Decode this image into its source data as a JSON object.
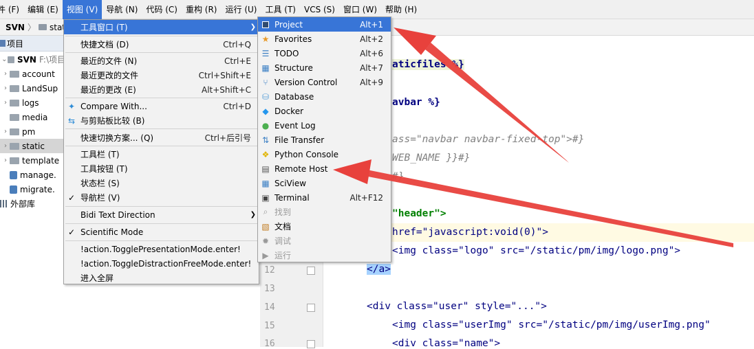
{
  "menubar": {
    "items": [
      "件 (F)",
      "编辑 (E)",
      "视图 (V)",
      "导航 (N)",
      "代码 (C)",
      "重构 (R)",
      "运行 (U)",
      "工具 (T)",
      "VCS (S)",
      "窗口 (W)",
      "帮助 (H)"
    ]
  },
  "breadcrumb": {
    "project": "SVN",
    "folder": "stati"
  },
  "project_panel": {
    "title": "项目"
  },
  "tree": {
    "root_name": "SVN",
    "root_path": "F:\\项目",
    "items": [
      "account",
      "LandSup",
      "logs",
      "media",
      "pm",
      "static",
      "template",
      "manage.",
      "migrate.",
      "外部库"
    ]
  },
  "view_menu": {
    "items": [
      {
        "label": "工具窗口 (T)",
        "shortcut": ""
      },
      {
        "label": "快捷文档 (D)",
        "shortcut": "Ctrl+Q"
      },
      {
        "label": "最近的文件 (N)",
        "shortcut": "Ctrl+E"
      },
      {
        "label": "最近更改的文件",
        "shortcut": "Ctrl+Shift+E"
      },
      {
        "label": "最近的更改 (E)",
        "shortcut": "Alt+Shift+C"
      },
      {
        "label": "Compare With...",
        "shortcut": "Ctrl+D"
      },
      {
        "label": "与剪贴板比较 (B)",
        "shortcut": ""
      },
      {
        "label": "快速切换方案... (Q)",
        "shortcut": "Ctrl+后引号"
      },
      {
        "label": "工具栏 (T)",
        "shortcut": ""
      },
      {
        "label": "工具按钮 (T)",
        "shortcut": ""
      },
      {
        "label": "状态栏 (S)",
        "shortcut": ""
      },
      {
        "label": "导航栏 (V)",
        "shortcut": ""
      },
      {
        "label": "Bidi Text Direction",
        "shortcut": ""
      },
      {
        "label": "Scientific Mode",
        "shortcut": ""
      },
      {
        "label": "!action.TogglePresentationMode.enter!",
        "shortcut": ""
      },
      {
        "label": "!action.ToggleDistractionFreeMode.enter!",
        "shortcut": ""
      },
      {
        "label": "进入全屏",
        "shortcut": ""
      }
    ]
  },
  "tool_windows_menu": {
    "items": [
      {
        "label": "Project",
        "shortcut": "Alt+1"
      },
      {
        "label": "Favorites",
        "shortcut": "Alt+2"
      },
      {
        "label": "TODO",
        "shortcut": "Alt+6"
      },
      {
        "label": "Structure",
        "shortcut": "Alt+7"
      },
      {
        "label": "Version Control",
        "shortcut": "Alt+9"
      },
      {
        "label": "Database",
        "shortcut": ""
      },
      {
        "label": "Docker",
        "shortcut": ""
      },
      {
        "label": "Event Log",
        "shortcut": ""
      },
      {
        "label": "File Transfer",
        "shortcut": ""
      },
      {
        "label": "Python Console",
        "shortcut": ""
      },
      {
        "label": "Remote Host",
        "shortcut": ""
      },
      {
        "label": "SciView",
        "shortcut": ""
      },
      {
        "label": "Terminal",
        "shortcut": "Alt+F12"
      },
      {
        "label": "找到",
        "shortcut": ""
      },
      {
        "label": "文档",
        "shortcut": ""
      },
      {
        "label": "调试",
        "shortcut": ""
      },
      {
        "label": "运行",
        "shortcut": ""
      }
    ]
  },
  "editor": {
    "line_numbers": [
      "12",
      "13",
      "14",
      "15",
      "16"
    ],
    "lines": [
      "aticfiles %}",
      "avbar %}",
      "ass=\"navbar navbar-fixed-top\">#}",
      "WEB_NAME }}#}",
      "#}",
      "\"header\">",
      "href=\"javascript:void(0)\">",
      "<img class=\"logo\" src=\"/static/pm/img/logo.png\">",
      "</a>",
      "<div class=\"user\" style=\"...\">",
      "<img class=\"userImg\" src=\"/static/pm/img/userImg.png\"",
      "<div class=\"name\">"
    ]
  },
  "colors": {
    "accent": "#3875d7",
    "arrow": "#e8413c"
  }
}
